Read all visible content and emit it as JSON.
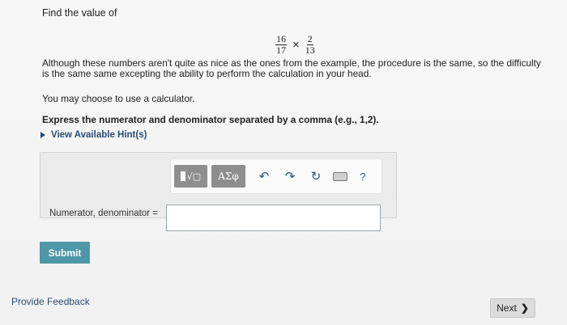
{
  "question": {
    "prompt": "Find the value of",
    "fraction_a": {
      "numerator": "16",
      "denominator": "17"
    },
    "operator": "×",
    "fraction_b": {
      "numerator": "2",
      "denominator": "13"
    },
    "paragraph": "Although these numbers aren't quite as nice as the ones from the example, the procedure is the same, so the difficulty is the same same excepting the ability to perform the calculation in your head.",
    "calculator_note": "You may choose to use a calculator.",
    "instruction": "Express the numerator and denominator separated by a comma (e.g., 1,2).",
    "hint_link": "View Available Hint(s)"
  },
  "toolbar": {
    "templates_glyph": "√▢",
    "greek_label": "ΑΣφ",
    "undo_glyph": "↶",
    "redo_glyph": "↷",
    "reset_glyph": "↻",
    "help_label": "?"
  },
  "answer": {
    "label": "Numerator, denominator =",
    "value": ""
  },
  "buttons": {
    "submit": "Submit",
    "next": "Next",
    "next_glyph": "❯",
    "feedback": "Provide Feedback"
  },
  "colors": {
    "link": "#2a4a73",
    "submit_bg": "#4e97a6",
    "toolbar_button": "#8e8e8e"
  }
}
